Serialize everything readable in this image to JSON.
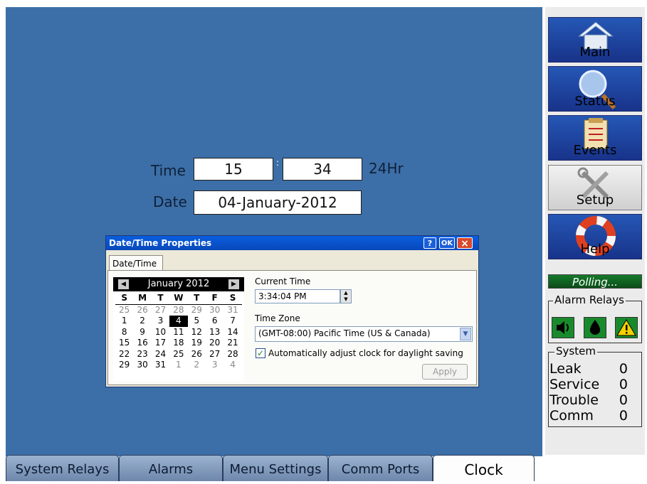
{
  "main": {
    "time_label": "Time",
    "hours": "15",
    "minutes": "34",
    "separator": ":",
    "time_format": "24Hr",
    "date_label": "Date",
    "date_value": "04-January-2012"
  },
  "dialog": {
    "title": "Date/Time Properties",
    "help_btn": "?",
    "ok_btn": "OK",
    "close_btn": "×",
    "tab": "Date/Time",
    "calendar": {
      "month_year": "January 2012",
      "prev": "◀",
      "next": "▶",
      "weekdays": [
        "S",
        "M",
        "T",
        "W",
        "T",
        "F",
        "S"
      ],
      "weeks": [
        [
          "25",
          "26",
          "27",
          "28",
          "29",
          "30",
          "31"
        ],
        [
          "1",
          "2",
          "3",
          "4",
          "5",
          "6",
          "7"
        ],
        [
          "8",
          "9",
          "10",
          "11",
          "12",
          "13",
          "14"
        ],
        [
          "15",
          "16",
          "17",
          "18",
          "19",
          "20",
          "21"
        ],
        [
          "22",
          "23",
          "24",
          "25",
          "26",
          "27",
          "28"
        ],
        [
          "29",
          "30",
          "31",
          "1",
          "2",
          "3",
          "4"
        ]
      ],
      "selected_day": "4"
    },
    "current_time_label": "Current Time",
    "current_time_value": "3:34:04 PM",
    "time_zone_label": "Time Zone",
    "time_zone_value": "(GMT-08:00) Pacific Time (US & Canada)",
    "dst_checked": true,
    "dst_label": "Automatically adjust clock for daylight saving",
    "apply_btn": "Apply"
  },
  "side_nav": {
    "items": [
      {
        "label": "Main",
        "icon": "home-icon"
      },
      {
        "label": "Status",
        "icon": "magnifier-icon"
      },
      {
        "label": "Events",
        "icon": "clipboard-icon"
      },
      {
        "label": "Setup",
        "icon": "tools-icon"
      },
      {
        "label": "Help",
        "icon": "lifebuoy-icon"
      }
    ],
    "active": "Setup"
  },
  "polling": "Polling...",
  "alarm_relays": {
    "title": "Alarm Relays",
    "icons": [
      "speaker-icon",
      "drop-icon",
      "warning-icon"
    ]
  },
  "system": {
    "title": "System",
    "rows": [
      {
        "label": "Leak",
        "value": "0"
      },
      {
        "label": "Service",
        "value": "0"
      },
      {
        "label": "Trouble",
        "value": "0"
      },
      {
        "label": "Comm",
        "value": "0"
      }
    ]
  },
  "bottom_tabs": [
    "System Relays",
    "Alarms",
    "Menu Settings",
    "Comm Ports",
    "Clock"
  ],
  "colors": {
    "background": "#3c6fa7",
    "dialog_title": "#0a5ee0",
    "relay_green": "#198a2c"
  }
}
